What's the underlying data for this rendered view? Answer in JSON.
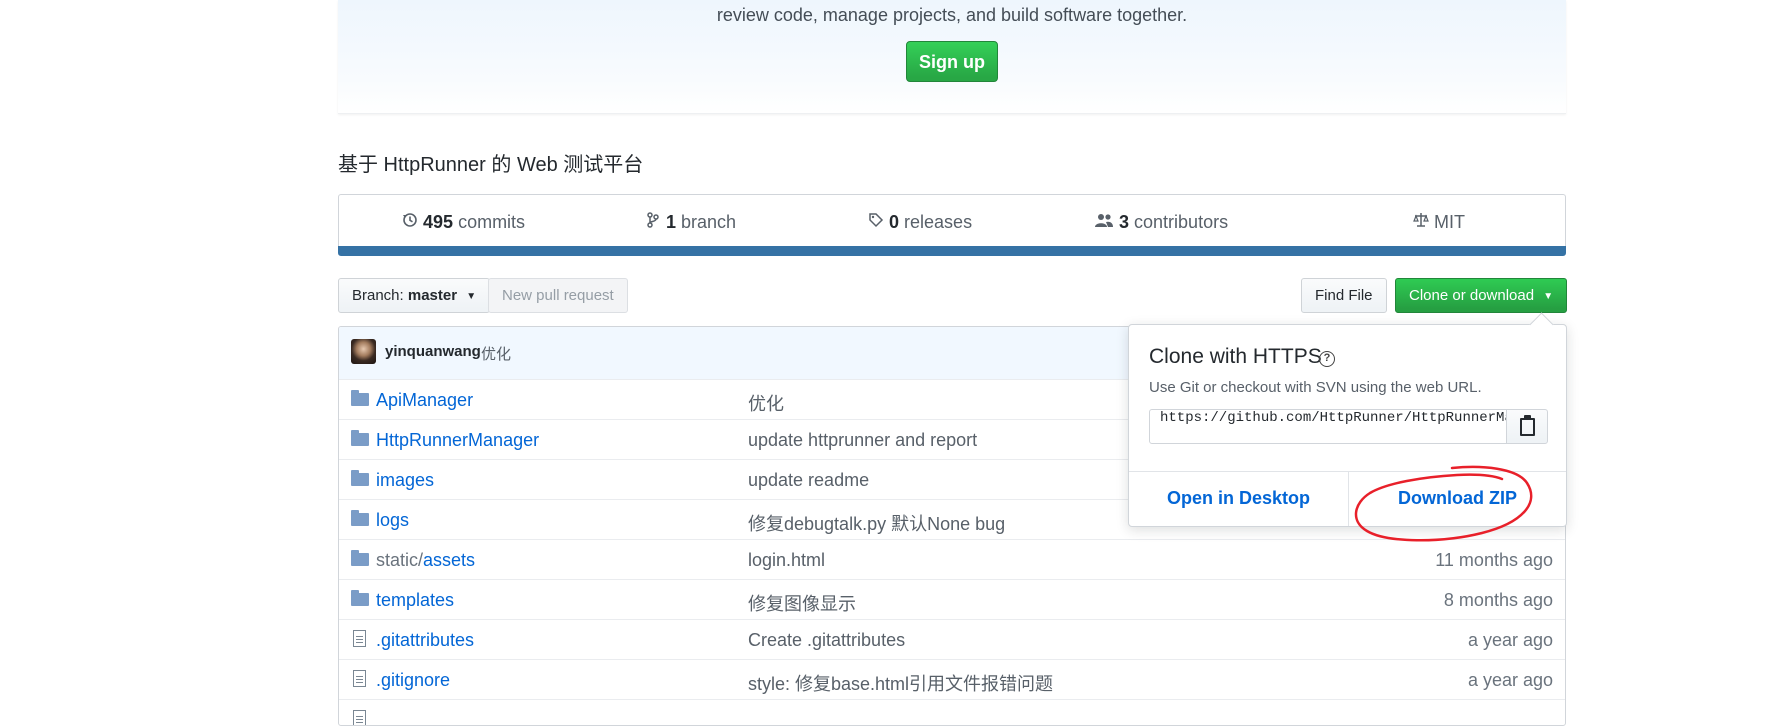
{
  "banner": {
    "tagline": "review code, manage projects, and build software together.",
    "signup_label": "Sign up"
  },
  "repo": {
    "description": "基于 HttpRunner 的 Web 测试平台"
  },
  "numbers": {
    "commits_count": "495",
    "commits_label": "commits",
    "branch_count": "1",
    "branch_label": "branch",
    "releases_count": "0",
    "releases_label": "releases",
    "contributors_count": "3",
    "contributors_label": "contributors",
    "license": "MIT"
  },
  "language_bar_color": "#3572a5",
  "toolbar": {
    "branch_prefix": "Branch:",
    "branch_name": "master",
    "new_pr_label": "New pull request",
    "find_file_label": "Find File",
    "clone_label": "Clone or download"
  },
  "commit": {
    "author": "yinquanwang",
    "message": "优化"
  },
  "files": [
    {
      "type": "folder",
      "name": "ApiManager",
      "message": "优化",
      "age": ""
    },
    {
      "type": "folder",
      "name": "HttpRunnerManager",
      "message": "update httprunner and report",
      "age": ""
    },
    {
      "type": "folder",
      "name": "images",
      "message": "update readme",
      "age": ""
    },
    {
      "type": "folder",
      "name": "logs",
      "message": "修复debugtalk.py 默认None bug",
      "age": ""
    },
    {
      "type": "folder",
      "name_prefix": "static/",
      "name": "assets",
      "message": "login.html",
      "age": "11 months ago"
    },
    {
      "type": "folder",
      "name": "templates",
      "message": "修复图像显示",
      "age": "8 months ago"
    },
    {
      "type": "file",
      "name": ".gitattributes",
      "message": "Create .gitattributes",
      "age": "a year ago"
    },
    {
      "type": "file",
      "name": ".gitignore",
      "message": "style: 修复base.html引用文件报错问题",
      "age": "a year ago"
    }
  ],
  "clone_dropdown": {
    "title": "Clone with HTTPS",
    "subtitle": "Use Git or checkout with SVN using the web URL.",
    "url": "https://github.com/HttpRunner/HttpRunnerManager.git",
    "open_desktop_label": "Open in Desktop",
    "download_zip_label": "Download ZIP"
  },
  "colors": {
    "link": "#0366d6",
    "green": "#28a745",
    "annotation": "#e8202a"
  }
}
